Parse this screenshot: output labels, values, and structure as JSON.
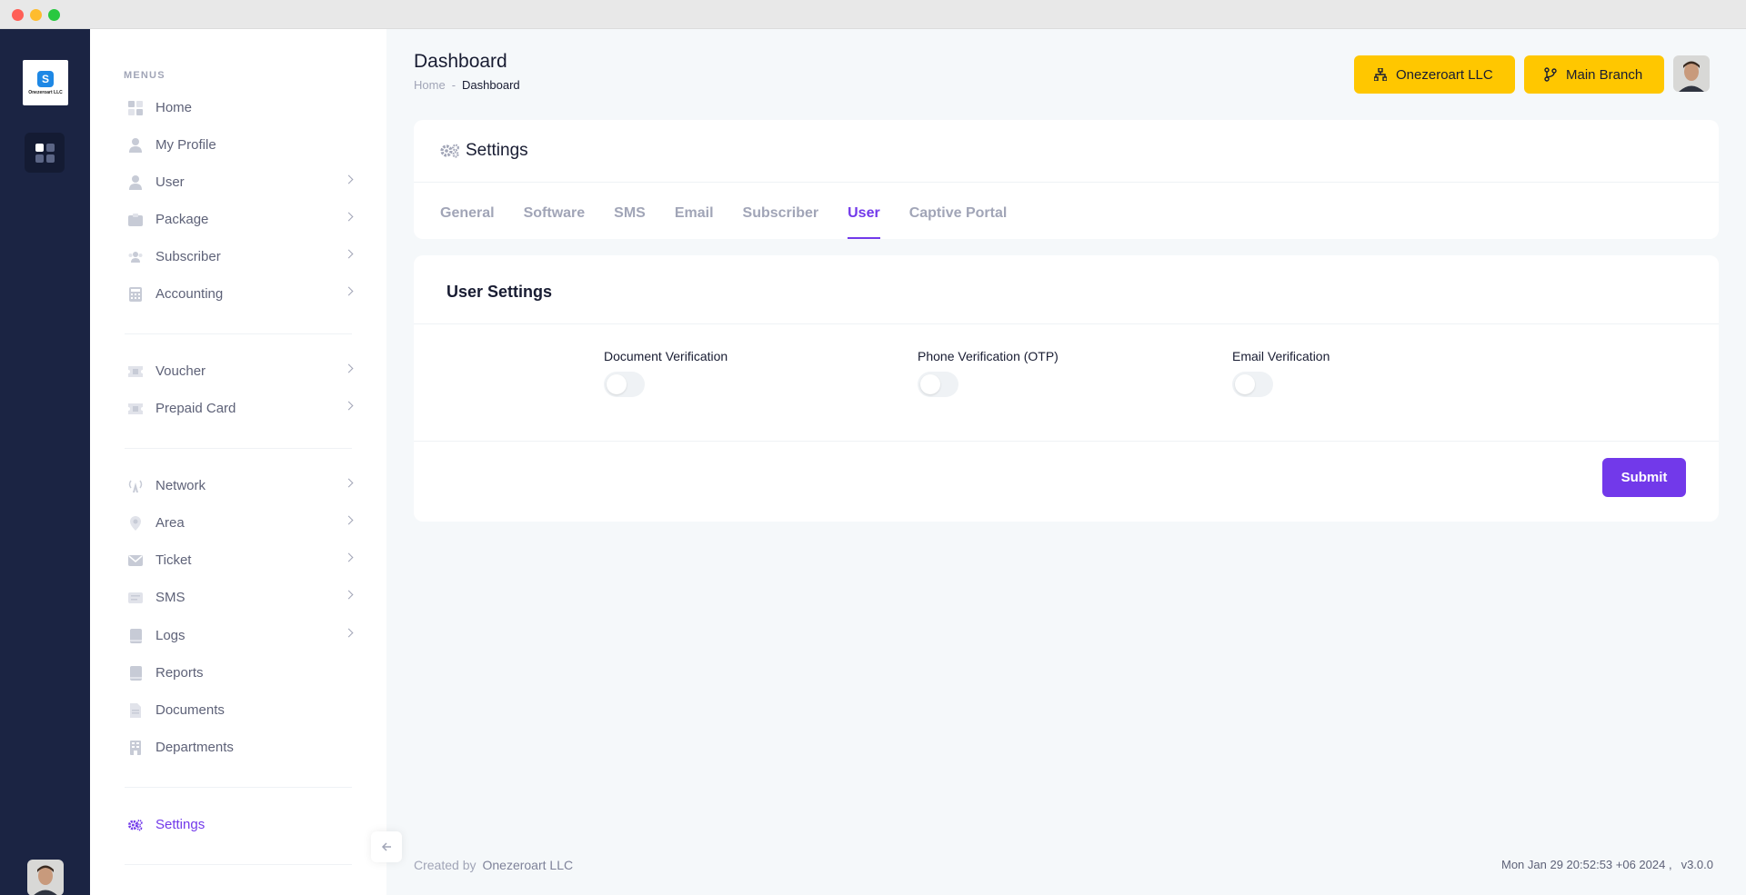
{
  "brand": {
    "logo_text": "Onezeroart LLC",
    "logo_letter": "S"
  },
  "sidebar": {
    "menus_label": "MENUS",
    "items": [
      {
        "label": "Home",
        "icon": "home-grid-icon",
        "has_children": false
      },
      {
        "label": "My Profile",
        "icon": "user-icon",
        "has_children": false
      },
      {
        "label": "User",
        "icon": "user-icon",
        "has_children": true
      },
      {
        "label": "Package",
        "icon": "package-icon",
        "has_children": true
      },
      {
        "label": "Subscriber",
        "icon": "users-icon",
        "has_children": true
      },
      {
        "label": "Accounting",
        "icon": "calculator-icon",
        "has_children": true
      },
      {
        "label": "Voucher",
        "icon": "ticket-icon",
        "has_children": true
      },
      {
        "label": "Prepaid Card",
        "icon": "card-icon",
        "has_children": true
      },
      {
        "label": "Network",
        "icon": "antenna-icon",
        "has_children": true
      },
      {
        "label": "Area",
        "icon": "map-pin-icon",
        "has_children": true
      },
      {
        "label": "Ticket",
        "icon": "envelope-icon",
        "has_children": true
      },
      {
        "label": "SMS",
        "icon": "message-icon",
        "has_children": true
      },
      {
        "label": "Logs",
        "icon": "book-icon",
        "has_children": true
      },
      {
        "label": "Reports",
        "icon": "book-icon",
        "has_children": false
      },
      {
        "label": "Documents",
        "icon": "document-icon",
        "has_children": false
      },
      {
        "label": "Departments",
        "icon": "building-icon",
        "has_children": false
      },
      {
        "label": "Settings",
        "icon": "gears-icon",
        "has_children": false,
        "active": true
      }
    ]
  },
  "header": {
    "title": "Dashboard",
    "breadcrumb_home": "Home",
    "breadcrumb_sep": "-",
    "breadcrumb_current": "Dashboard",
    "company_button": "Onezeroart LLC",
    "branch_button": "Main Branch"
  },
  "settings_card": {
    "title": "Settings",
    "tabs": [
      "General",
      "Software",
      "SMS",
      "Email",
      "Subscriber",
      "User",
      "Captive Portal"
    ],
    "active_tab": "User"
  },
  "user_settings": {
    "title": "User Settings",
    "fields": [
      {
        "label": "Document Verification",
        "enabled": false
      },
      {
        "label": "Phone Verification (OTP)",
        "enabled": false
      },
      {
        "label": "Email Verification",
        "enabled": false
      }
    ],
    "submit_label": "Submit"
  },
  "footer": {
    "created_by_label": "Created by",
    "created_by_name": "Onezeroart LLC",
    "datetime": "Mon Jan 29 20:52:53 +06 2024 ,",
    "version": "v3.0.0"
  },
  "colors": {
    "accent": "#7239ea",
    "header_button": "#ffc700",
    "rail": "#1b2443"
  }
}
